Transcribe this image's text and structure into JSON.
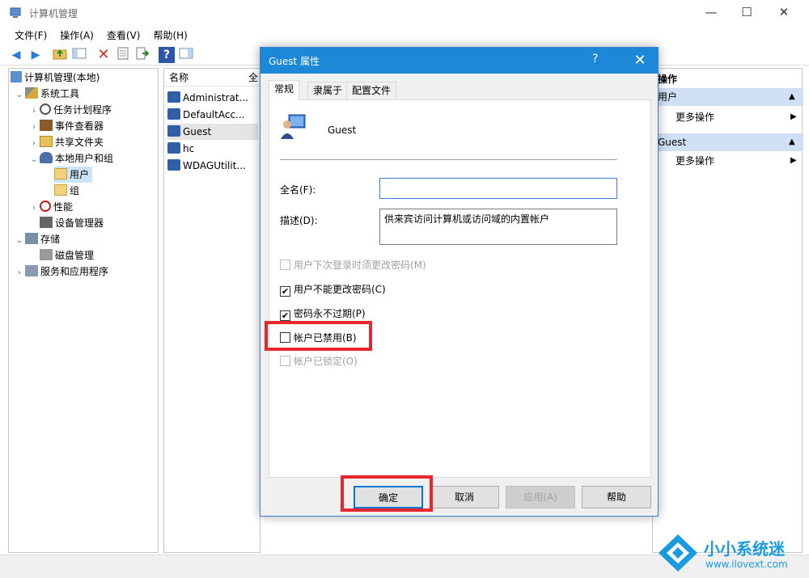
{
  "window": {
    "title": "计算机管理",
    "controls": {
      "minimize": "—",
      "maximize": "☐",
      "close": "✕"
    }
  },
  "menubar": [
    "文件(F)",
    "操作(A)",
    "查看(V)",
    "帮助(H)"
  ],
  "tree": [
    {
      "label": "计算机管理(本地)",
      "expander": "",
      "level": 0
    },
    {
      "label": "系统工具",
      "expander": "⌄",
      "level": 1
    },
    {
      "label": "任务计划程序",
      "expander": "›",
      "level": 2
    },
    {
      "label": "事件查看器",
      "expander": "›",
      "level": 2
    },
    {
      "label": "共享文件夹",
      "expander": "›",
      "level": 2
    },
    {
      "label": "本地用户和组",
      "expander": "⌄",
      "level": 2
    },
    {
      "label": "用户",
      "expander": "",
      "level": 3,
      "selected": true
    },
    {
      "label": "组",
      "expander": "",
      "level": 3
    },
    {
      "label": "性能",
      "expander": "›",
      "level": 2
    },
    {
      "label": "设备管理器",
      "expander": "",
      "level": 2
    },
    {
      "label": "存储",
      "expander": "⌄",
      "level": 1
    },
    {
      "label": "磁盘管理",
      "expander": "",
      "level": 2
    },
    {
      "label": "服务和应用程序",
      "expander": "›",
      "level": 1
    }
  ],
  "list": {
    "header": "名称",
    "header2": "全",
    "items": [
      "Administrat...",
      "DefaultAcc...",
      "Guest",
      "hc",
      "WDAGUtilit..."
    ]
  },
  "ops": {
    "header": "操作",
    "section1": "用户",
    "more1": "更多操作",
    "section2": "Guest",
    "more2": "更多操作",
    "arrow": "▶"
  },
  "dialog": {
    "title": "Guest 属性",
    "help": "?",
    "close": "✕",
    "tabs": [
      "常规",
      "隶属于",
      "配置文件"
    ],
    "username": "Guest",
    "fullname_label": "全名(F):",
    "fullname_value": "",
    "description_label": "描述(D):",
    "description_value": "供来宾访问计算机或访问域的内置帐户",
    "checks": [
      {
        "label": "用户下次登录时须更改密码(M)",
        "checked": false,
        "disabled": true
      },
      {
        "label": "用户不能更改密码(C)",
        "checked": true,
        "disabled": false
      },
      {
        "label": "密码永不过期(P)",
        "checked": true,
        "disabled": false
      },
      {
        "label": "帐户已禁用(B)",
        "checked": false,
        "disabled": false
      },
      {
        "label": "帐户已锁定(O)",
        "checked": false,
        "disabled": true
      }
    ],
    "buttons": {
      "ok": "确定",
      "cancel": "取消",
      "apply": "应用(A)",
      "help": "帮助"
    }
  },
  "watermark": {
    "title": "小小系统迷",
    "url": "www.ilovext.com"
  },
  "colors": {
    "titlebar": "#1e88d8",
    "highlight": "#e8262e",
    "selected": "#cce4f7"
  }
}
